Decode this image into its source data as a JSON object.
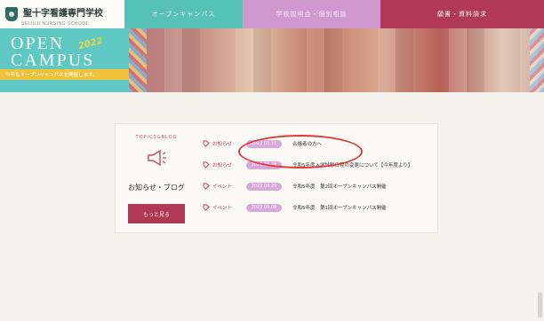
{
  "header": {
    "school_name": "聖十字看護専門学校",
    "school_sub": "SEIJUJI NURSING SCHOOL",
    "nav": {
      "open_campus": "オープンキャンパス",
      "event": "学校説明会・個別相談",
      "apply": "願書・資料請求"
    }
  },
  "hero": {
    "title_line1": "OPEN",
    "title_line2": "CAMPUS",
    "badge": "2022",
    "banner": "今年もオープンキャンパスを開催します。"
  },
  "news": {
    "topics_label": "TOPICS&BLOG",
    "heading": "お知らせ・ブログ",
    "more_button": "もっと見る",
    "items": [
      {
        "category": "お知らせ",
        "date": "2022.05.11",
        "title": "合格者の方へ"
      },
      {
        "category": "お知らせ",
        "date": "2022.04.28",
        "title": "令和5年度入学試験日程の変更について【今年度より】"
      },
      {
        "category": "イベント",
        "date": "2022.04.20",
        "title": "令和5年度　第2回オープンキャンパス開催"
      },
      {
        "category": "イベント",
        "date": "2022.04.08",
        "title": "令和5年度　第1回オープンキャンパス開催"
      }
    ]
  },
  "colors": {
    "teal": "#56c1b6",
    "pink": "#cf99cf",
    "crimson": "#b03a55",
    "highlight": "#e03a3a"
  }
}
